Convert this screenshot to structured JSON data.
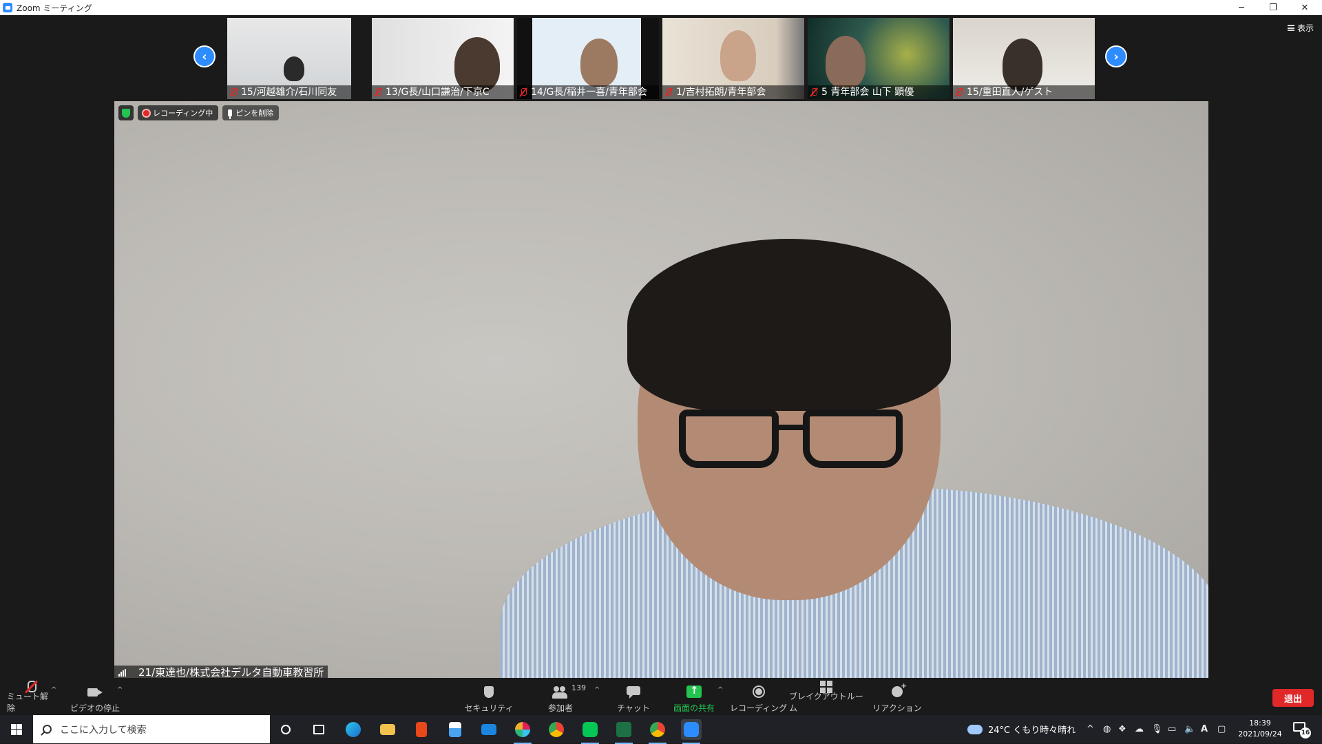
{
  "window": {
    "title": "Zoom ミーティング",
    "minimize": "─",
    "restore": "❐",
    "close": "✕"
  },
  "gallery": {
    "view_label": "表示",
    "prev_arrow": "‹",
    "next_arrow": "›",
    "participants": [
      {
        "label": "15/河越雄介/石川同友"
      },
      {
        "label": "13/G長/山口謙治/下京C"
      },
      {
        "label": "14/G長/稲井一喜/青年部会"
      },
      {
        "label": "1/吉村拓朗/青年部会"
      },
      {
        "label": "5 青年部会 山下 顕優"
      },
      {
        "label": "15/重田直人/ゲスト"
      }
    ]
  },
  "main_video": {
    "recording_label": "レコーディング中",
    "unpin_label": "ピンを削除",
    "speaker_label": "21/東達也/株式会社デルタ自動車教習所"
  },
  "toolbar": {
    "unmute": "ミュート解除",
    "stop_video": "ビデオの停止",
    "security": "セキュリティ",
    "participants": "参加者",
    "participant_count": "139",
    "chat": "チャット",
    "share_screen": "画面の共有",
    "recording": "レコーディング",
    "breakout": "ブレイクアウトルーム",
    "reactions": "リアクション",
    "leave": "退出",
    "caret": "^",
    "accent_share": "#23c450",
    "accent_leave": "#e02828"
  },
  "taskbar": {
    "search_placeholder": "ここに入力して検索",
    "weather": "24°C くもり時々晴れ",
    "ime": "A",
    "time": "18:39",
    "date": "2021/09/24",
    "notifications": "16"
  }
}
